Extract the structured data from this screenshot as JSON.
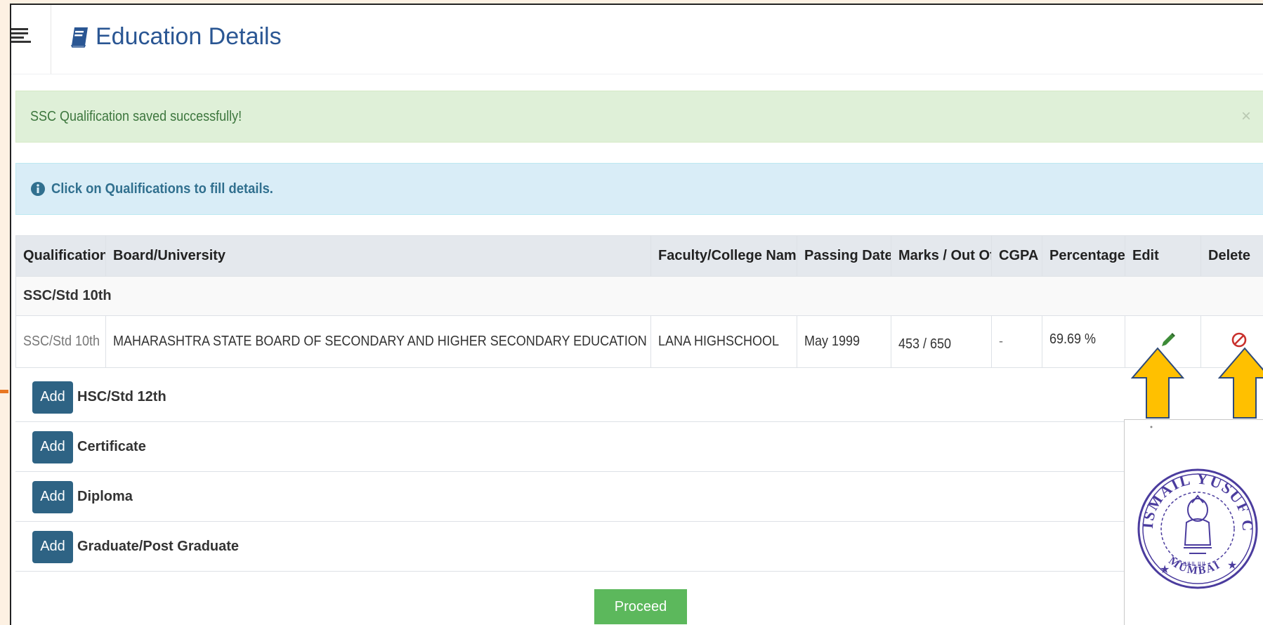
{
  "header": {
    "title": "Education Details"
  },
  "alerts": {
    "success": "SSC Qualification saved successfully!",
    "success_close": "×",
    "info": "Click on Qualifications to fill details."
  },
  "table": {
    "headers": {
      "qualification": "Qualification",
      "board": "Board/University",
      "faculty": "Faculty/College Name",
      "passing_date": "Passing Date",
      "marks": "Marks / Out Of",
      "cgpa": "CGPA",
      "percentage": "Percentage",
      "edit": "Edit",
      "delete": "Delete"
    },
    "group_label": "SSC/Std 10th",
    "row": {
      "qualification": "SSC/Std 10th",
      "board": "MAHARASHTRA STATE BOARD OF SECONDARY AND HIGHER SECONDARY EDUCATION",
      "faculty": "LANA HIGHSCHOOL",
      "passing_date": "May 1999",
      "marks": "453 / 650",
      "cgpa": "-",
      "percentage": "69.69 %"
    }
  },
  "add_button_label": "Add",
  "add_rows": {
    "hsc": "HSC/Std 12th",
    "certificate": "Certificate",
    "diploma": "Diploma",
    "graduate": "Graduate/Post Graduate"
  },
  "proceed_label": "Proceed",
  "seal": {
    "top_text": "ISMAIL YUSUF COLLEGE",
    "bottom_text": "MUMBAI"
  },
  "colors": {
    "title_blue": "#2a5693",
    "success_bg": "#dff0d8",
    "info_bg": "#d9edf7",
    "add_button": "#2e6384",
    "proceed_button": "#5cb85c",
    "edit_icon": "#3d8b37",
    "delete_icon": "#c9302c",
    "arrow_fill": "#ffc000",
    "seal_ink": "#4b3c9e"
  },
  "icons": {
    "menu": "hamburger-icon",
    "title": "book-icon",
    "info": "info-circle-icon",
    "edit": "pencil-icon",
    "delete": "ban-icon"
  }
}
